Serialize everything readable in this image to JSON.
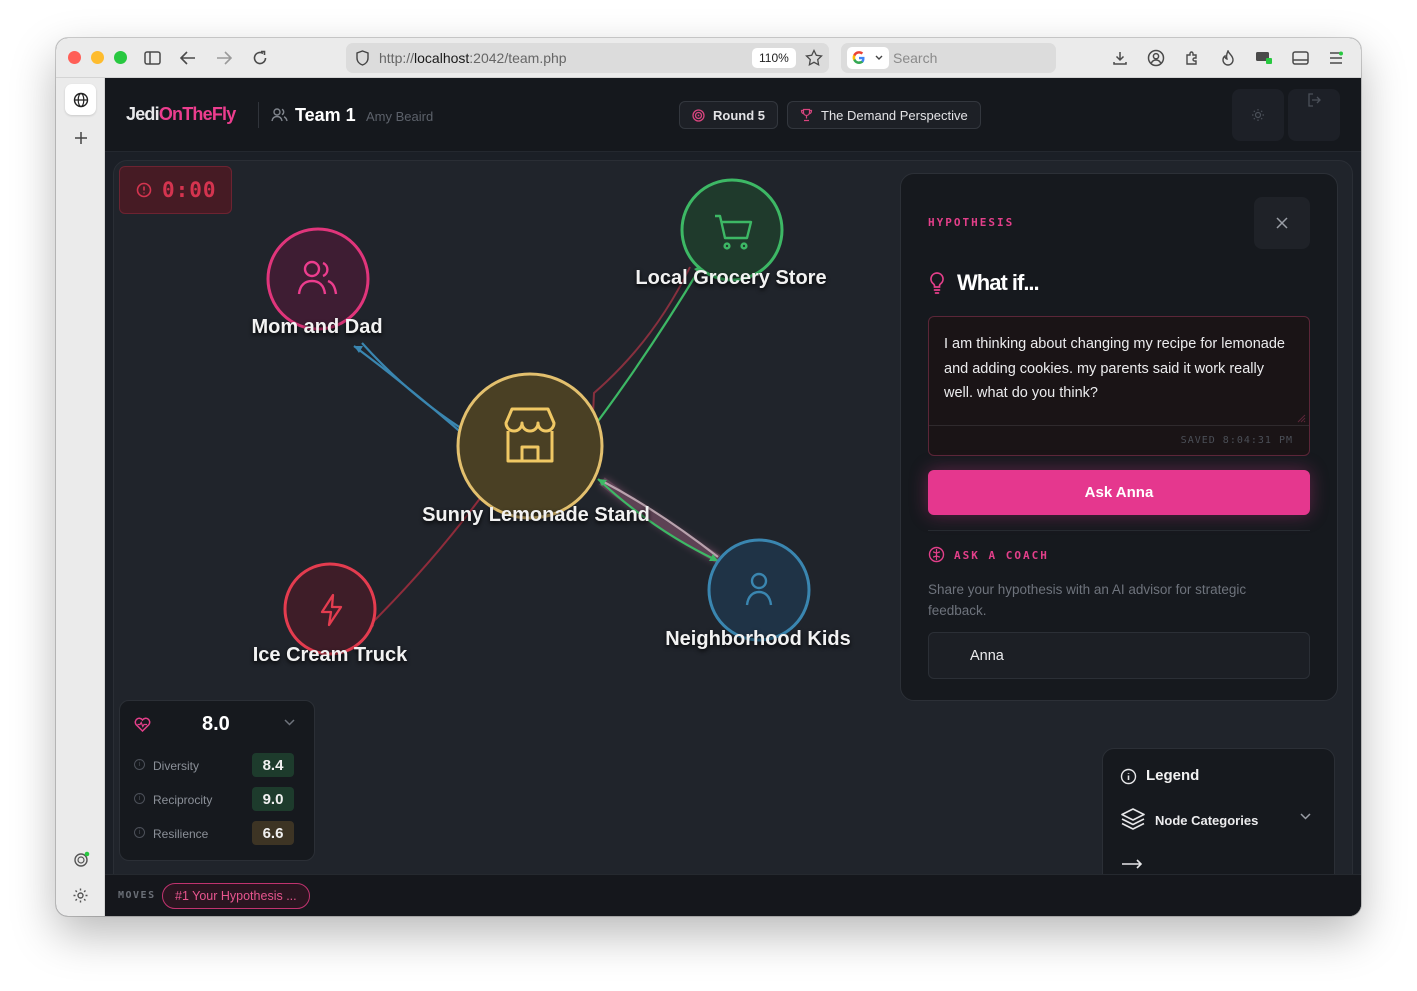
{
  "browser": {
    "url_prefix": "http://",
    "url_host": "localhost",
    "url_rest": ":2042/team.php",
    "zoom": "110%",
    "search_placeholder": "Search"
  },
  "header": {
    "brand_main": "Jedi",
    "brand_accent": "OnTheFly",
    "team_title": "Team 1",
    "team_member": "Amy Beaird",
    "round_label": "Round 5",
    "perspective_label": "The Demand Perspective"
  },
  "timer": {
    "value": "0:00"
  },
  "graph": {
    "nodes": [
      {
        "id": "center",
        "label": "Sunny Lemonade Stand",
        "icon": "store-icon",
        "color": "#e3c06e"
      },
      {
        "id": "parents",
        "label": "Mom and Dad",
        "icon": "users-icon",
        "color": "#e0357b"
      },
      {
        "id": "grocery",
        "label": "Local Grocery Store",
        "icon": "cart-icon",
        "color": "#3db865"
      },
      {
        "id": "icecream",
        "label": "Ice Cream Truck",
        "icon": "bolt-icon",
        "color": "#e43c4f"
      },
      {
        "id": "kids",
        "label": "Neighborhood Kids",
        "icon": "user-icon",
        "color": "#3a86b0"
      }
    ]
  },
  "panel": {
    "kicker": "HYPOTHESIS",
    "title": "What if...",
    "hypothesis_text": "I am thinking about changing my recipe for lemonade and adding cookies.  my parents said it work really well. what do you think?",
    "saved_text": "SAVED 8:04:31 PM",
    "ask_button": "Ask Anna",
    "coach_kicker": "ASK A COACH",
    "coach_desc": "Share your hypothesis with an AI advisor for strategic feedback.",
    "coach_selected": "Anna"
  },
  "score": {
    "overall": "8.0",
    "metrics": [
      {
        "label": "Diversity",
        "value": "8.4",
        "color": "#1d3b2c"
      },
      {
        "label": "Reciprocity",
        "value": "9.0",
        "color": "#1d3b2c"
      },
      {
        "label": "Resilience",
        "value": "6.6",
        "color": "#3d3424"
      }
    ]
  },
  "legend": {
    "title": "Legend",
    "node_categories": "Node Categories"
  },
  "moves": {
    "label": "MOVES",
    "chip": "#1 Your Hypothesis ..."
  },
  "colors": {
    "accent": "#e5378e",
    "edge_blue": "#3a86b0",
    "edge_green": "#3db865",
    "edge_red": "#b3303f"
  }
}
